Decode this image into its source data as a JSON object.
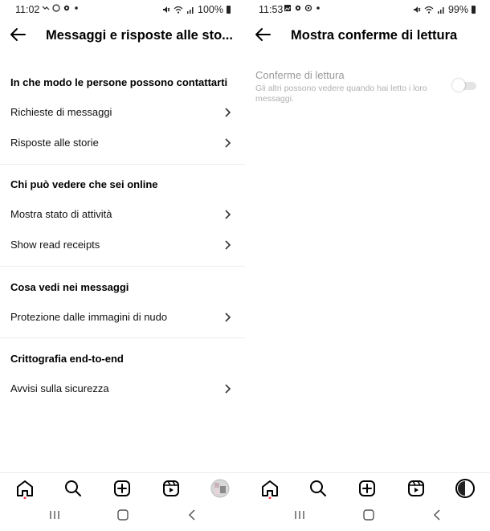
{
  "left": {
    "status": {
      "time": "11:02",
      "battery": "100%"
    },
    "header": {
      "title": "Messaggi e risposte alle sto..."
    },
    "sections": [
      {
        "title": "In che modo le persone possono contattarti",
        "items": [
          {
            "label": "Richieste di messaggi"
          },
          {
            "label": "Risposte alle storie"
          }
        ]
      },
      {
        "title": "Chi può vedere che sei online",
        "items": [
          {
            "label": "Mostra stato di attività"
          },
          {
            "label": "Show read receipts"
          }
        ]
      },
      {
        "title": "Cosa vedi nei messaggi",
        "items": [
          {
            "label": "Protezione dalle immagini di nudo"
          }
        ]
      },
      {
        "title": "Crittografia end-to-end",
        "items": [
          {
            "label": "Avvisi sulla sicurezza"
          }
        ]
      }
    ],
    "nav": [
      "home-icon",
      "search-icon",
      "create-icon",
      "reels-icon",
      "profile-avatar"
    ]
  },
  "right": {
    "status": {
      "time": "11:53",
      "battery": "99%"
    },
    "header": {
      "title": "Mostra conferme di lettura"
    },
    "setting": {
      "label": "Conferme di lettura",
      "description": "Gli altri possono vedere quando hai letto i loro messaggi.",
      "enabled": false
    },
    "nav": [
      "home-icon",
      "search-icon",
      "create-icon",
      "reels-icon",
      "profile-avatar"
    ]
  },
  "colors": {
    "accent_dot": "#ff3040",
    "text_secondary": "#9a9a9a",
    "toggle_track": "#e4e4e4"
  }
}
